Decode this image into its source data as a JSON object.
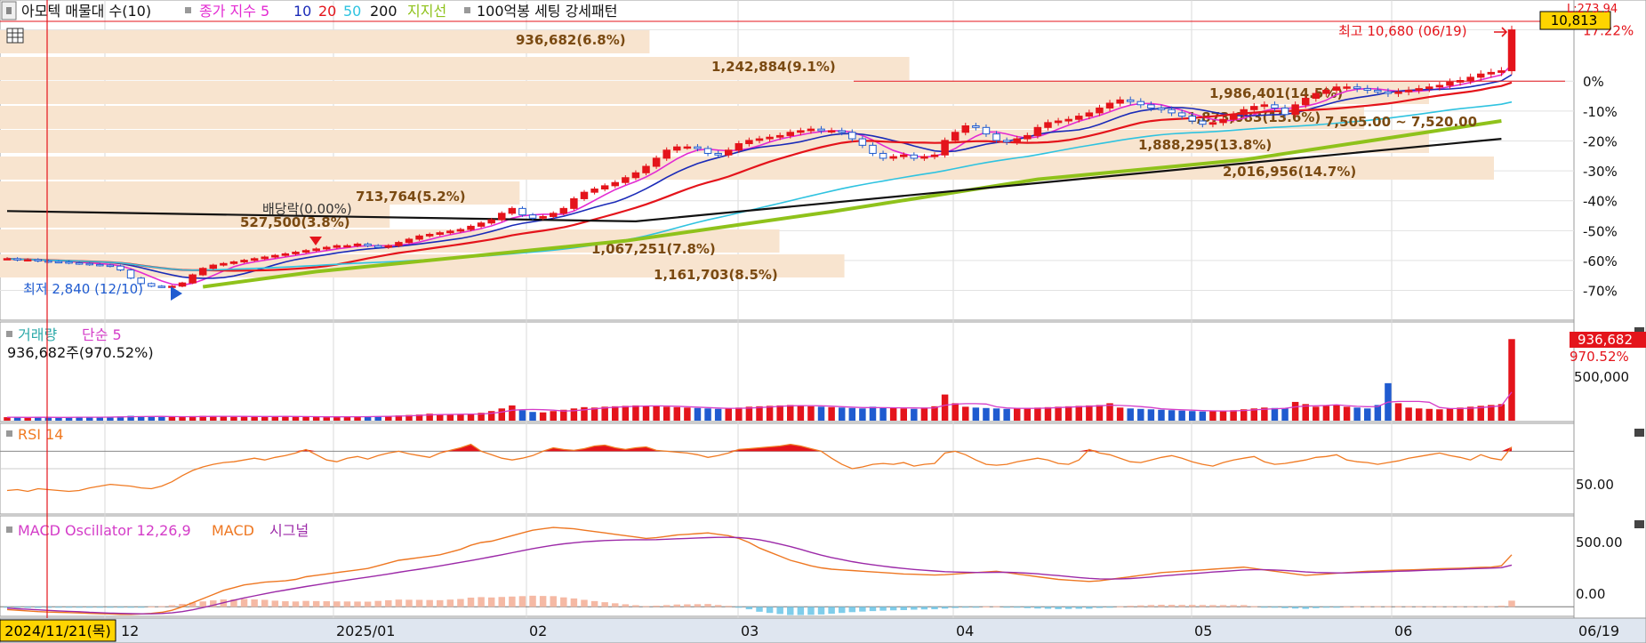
{
  "colors": {
    "up": "#e4141b",
    "down": "#1f5bd0",
    "ma5": "#e32ad2",
    "ma10": "#1b2bb8",
    "ma20": "#e4141b",
    "ma50": "#2fc3e0",
    "ma200": "#111111",
    "support": "#8fc21b",
    "volume_ma": "#d43cc8",
    "rsi": "#f07a22",
    "macd": "#ee7722",
    "signal": "#9c2aa8",
    "osc_pos": "#f5b9a4",
    "osc_neg": "#7fcdea",
    "profile": "#f8e4cf",
    "profile_text": "#7a4a12",
    "price_tag_bg": "#ffd400",
    "value_tag_bg": "#e4141b",
    "date_tag_bg": "#ffd400"
  },
  "top_bar": {
    "item1": "아모텍 매물대 수(10)",
    "ma_title": "종가 지수 5",
    "ma10": "10",
    "ma20": "20",
    "ma50": "50",
    "ma200": "200",
    "support": "지지선",
    "pattern": "100억봉 세팅 강세패턴"
  },
  "price_panel": {
    "current_price_tag": "10,813",
    "top_right_label": "L:273.94",
    "pct_labels": [
      "17.22%",
      "0%",
      "-10%",
      "-20%",
      "-30%",
      "-40%",
      "-50%",
      "-60%",
      "-70%"
    ],
    "high_label": "최고 10,680 (06/19)",
    "low_label": "최저 2,840 (12/10)",
    "dividend_label": "배당락(0.00%)",
    "range_label": "7,505.00 ~ 7,520.00",
    "profile_labels": [
      "936,682(6.8%)",
      "1,242,884(9.1%)",
      "1,986,401(14.5%)",
      "1,873,083(13.6%)",
      "1,888,295(13.8%)",
      "2,016,956(14.7%)",
      "713,764(5.2%)",
      "527,500(3.8%)",
      "1,067,251(7.8%)",
      "1,161,703(8.5%)"
    ]
  },
  "volume_panel": {
    "title": "거래량",
    "ma_label": "단순 5",
    "summary": "936,682주(970.52%)",
    "tag_value": "936,682",
    "tag_pct": "970.52%",
    "axis_label": "500,000"
  },
  "rsi_panel": {
    "title": "RSI 14",
    "axis_label": "50.00"
  },
  "macd_panel": {
    "title": "MACD Oscillator 12,26,9",
    "macd_label": "MACD",
    "signal_label": "시그널",
    "axis_labels": [
      "500.00",
      "0.00"
    ]
  },
  "x_axis": {
    "cursor_date": "2024/11/21(목)",
    "last_label": "06/19"
  },
  "chart_data": {
    "type": "line",
    "description_free": true,
    "x_ticks": [
      "12",
      "2025/01",
      "02",
      "03",
      "04",
      "05",
      "06"
    ],
    "price_pct_ticks": [
      17.22,
      0,
      -10,
      -20,
      -30,
      -40,
      -50,
      -60,
      -70
    ],
    "price_pct_range": [
      -74,
      20
    ],
    "reference_price": 9230,
    "close": [
      3750,
      3710,
      3720,
      3680,
      3660,
      3650,
      3620,
      3600,
      3570,
      3550,
      3520,
      3400,
      3150,
      2980,
      2900,
      2880,
      2900,
      3000,
      3250,
      3450,
      3550,
      3600,
      3650,
      3700,
      3750,
      3800,
      3850,
      3900,
      3950,
      4000,
      4050,
      4100,
      4150,
      4150,
      4200,
      4150,
      4100,
      4150,
      4250,
      4350,
      4450,
      4500,
      4550,
      4600,
      4650,
      4750,
      4850,
      4950,
      5150,
      5300,
      5100,
      5000,
      5050,
      5150,
      5300,
      5600,
      5800,
      5900,
      6000,
      6100,
      6250,
      6400,
      6600,
      6850,
      7100,
      7200,
      7200,
      7150,
      7000,
      6950,
      7100,
      7300,
      7400,
      7450,
      7500,
      7550,
      7650,
      7700,
      7750,
      7700,
      7700,
      7650,
      7450,
      7250,
      7000,
      6850,
      6900,
      6950,
      6850,
      6900,
      6950,
      7400,
      7650,
      7850,
      7800,
      7600,
      7400,
      7350,
      7450,
      7550,
      7800,
      7950,
      8000,
      8050,
      8150,
      8250,
      8400,
      8550,
      8650,
      8600,
      8500,
      8400,
      8350,
      8250,
      8150,
      8000,
      7900,
      7950,
      8050,
      8200,
      8350,
      8450,
      8500,
      8400,
      8200,
      8500,
      8700,
      8850,
      8950,
      9050,
      9050,
      9000,
      8950,
      8900,
      8850,
      8900,
      8950,
      9000,
      9050,
      9100,
      9200,
      9250,
      9350,
      9450,
      9500,
      9550,
      10813
    ],
    "ma_series": [
      {
        "name": "5",
        "period": 5
      },
      {
        "name": "10",
        "period": 10
      },
      {
        "name": "20",
        "period": 20
      },
      {
        "name": "50",
        "period": 50
      },
      {
        "name": "200",
        "period": 200
      }
    ],
    "support_line": {
      "name": "지지선",
      "x": [
        19,
        30,
        60,
        80,
        100,
        120,
        145
      ],
      "y": [
        2880,
        3350,
        4300,
        5200,
        6200,
        6800,
        8000
      ]
    },
    "black_line": {
      "name": "200",
      "x": [
        0,
        61,
        145
      ],
      "y": [
        5220,
        4900,
        7450
      ]
    },
    "volume_summary_value": 936682,
    "volume_axis_ticks": [
      500000
    ],
    "volume_ylim": [
      0,
      1000000
    ],
    "volume": [
      40,
      38,
      35,
      42,
      38,
      36,
      40,
      45,
      38,
      40,
      42,
      48,
      55,
      50,
      46,
      44,
      42,
      48,
      52,
      55,
      50,
      46,
      44,
      48,
      52,
      50,
      48,
      46,
      44,
      48,
      42,
      40,
      45,
      50,
      48,
      46,
      50,
      55,
      60,
      65,
      70,
      80,
      72,
      68,
      75,
      80,
      90,
      110,
      140,
      175,
      120,
      100,
      95,
      110,
      125,
      140,
      155,
      150,
      160,
      165,
      170,
      175,
      170,
      165,
      160,
      155,
      150,
      145,
      140,
      135,
      140,
      150,
      160,
      165,
      170,
      175,
      180,
      170,
      165,
      160,
      155,
      150,
      145,
      140,
      160,
      150,
      145,
      140,
      135,
      150,
      165,
      300,
      200,
      160,
      150,
      145,
      140,
      135,
      140,
      145,
      150,
      155,
      160,
      165,
      170,
      175,
      180,
      200,
      150,
      140,
      135,
      130,
      125,
      120,
      115,
      110,
      105,
      110,
      115,
      120,
      130,
      140,
      150,
      145,
      140,
      215,
      190,
      160,
      170,
      180,
      160,
      150,
      140,
      180,
      430,
      200,
      150,
      140,
      135,
      130,
      140,
      150,
      160,
      170,
      180,
      190,
      936
    ],
    "rsi_ticks": [
      50
    ],
    "rsi_ylim": [
      0,
      100
    ],
    "rsi_overbought": 70,
    "rsi": [
      25,
      26,
      24,
      27,
      26,
      25,
      24,
      25,
      28,
      30,
      32,
      31,
      30,
      28,
      27,
      30,
      35,
      42,
      48,
      52,
      55,
      57,
      58,
      60,
      62,
      60,
      63,
      65,
      68,
      72,
      66,
      60,
      58,
      62,
      64,
      61,
      65,
      68,
      70,
      67,
      65,
      63,
      68,
      71,
      74,
      78,
      70,
      66,
      62,
      60,
      62,
      65,
      70,
      74,
      72,
      71,
      73,
      76,
      77,
      74,
      72,
      74,
      75,
      71,
      70,
      69,
      68,
      66,
      63,
      65,
      68,
      72,
      73,
      74,
      75,
      76,
      78,
      76,
      73,
      70,
      62,
      55,
      50,
      52,
      55,
      56,
      55,
      57,
      53,
      55,
      56,
      68,
      70,
      66,
      60,
      55,
      54,
      55,
      58,
      60,
      62,
      60,
      56,
      55,
      60,
      72,
      68,
      66,
      62,
      58,
      57,
      60,
      63,
      65,
      62,
      58,
      55,
      53,
      57,
      60,
      62,
      64,
      58,
      55,
      56,
      58,
      60,
      63,
      64,
      66,
      60,
      58,
      57,
      55,
      57,
      59,
      62,
      64,
      66,
      68,
      65,
      63,
      60,
      66,
      62,
      60,
      75
    ],
    "macd_ticks": [
      500,
      0
    ],
    "macd_ylim": [
      -50,
      600
    ],
    "macd": [
      -20,
      -25,
      -30,
      -35,
      -38,
      -40,
      -42,
      -45,
      -48,
      -50,
      -52,
      -55,
      -55,
      -52,
      -48,
      -40,
      -25,
      0,
      30,
      60,
      90,
      120,
      140,
      160,
      170,
      180,
      185,
      190,
      200,
      220,
      230,
      240,
      250,
      260,
      270,
      280,
      300,
      320,
      340,
      350,
      360,
      370,
      380,
      400,
      420,
      450,
      470,
      480,
      500,
      520,
      540,
      560,
      570,
      580,
      575,
      570,
      560,
      550,
      540,
      530,
      520,
      510,
      500,
      505,
      515,
      525,
      530,
      535,
      540,
      530,
      520,
      500,
      470,
      430,
      400,
      370,
      340,
      320,
      300,
      285,
      275,
      270,
      265,
      260,
      255,
      250,
      245,
      240,
      238,
      235,
      232,
      235,
      240,
      245,
      250,
      255,
      260,
      250,
      240,
      230,
      220,
      210,
      200,
      195,
      190,
      185,
      190,
      200,
      210,
      220,
      230,
      240,
      250,
      255,
      260,
      265,
      270,
      275,
      280,
      285,
      290,
      280,
      270,
      260,
      250,
      240,
      230,
      235,
      240,
      245,
      250,
      255,
      260,
      262,
      265,
      268,
      270,
      272,
      275,
      278,
      280,
      282,
      285,
      288,
      290,
      300,
      380
    ],
    "signal": [
      -10,
      -14,
      -18,
      -22,
      -26,
      -30,
      -33,
      -36,
      -40,
      -43,
      -46,
      -48,
      -50,
      -51,
      -51,
      -49,
      -44,
      -35,
      -22,
      -6,
      12,
      30,
      48,
      65,
      80,
      95,
      110,
      122,
      135,
      148,
      160,
      172,
      184,
      195,
      206,
      217,
      228,
      240,
      252,
      264,
      275,
      287,
      299,
      312,
      325,
      338,
      352,
      366,
      380,
      395,
      410,
      425,
      438,
      450,
      460,
      468,
      475,
      480,
      484,
      487,
      489,
      490,
      490,
      491,
      494,
      497,
      500,
      503,
      506,
      508,
      508,
      506,
      500,
      490,
      475,
      458,
      440,
      420,
      398,
      378,
      360,
      345,
      330,
      318,
      307,
      297,
      288,
      280,
      273,
      267,
      262,
      257,
      254,
      252,
      251,
      251,
      252,
      252,
      250,
      246,
      241,
      234,
      228,
      221,
      214,
      208,
      204,
      203,
      204,
      207,
      212,
      218,
      225,
      231,
      237,
      242,
      248,
      254,
      259,
      264,
      269,
      271,
      271,
      269,
      266,
      261,
      255,
      251,
      249,
      248,
      248,
      250,
      252,
      254,
      257,
      260,
      262,
      265,
      268,
      270,
      273,
      275,
      278,
      280,
      283,
      286,
      305
    ]
  }
}
